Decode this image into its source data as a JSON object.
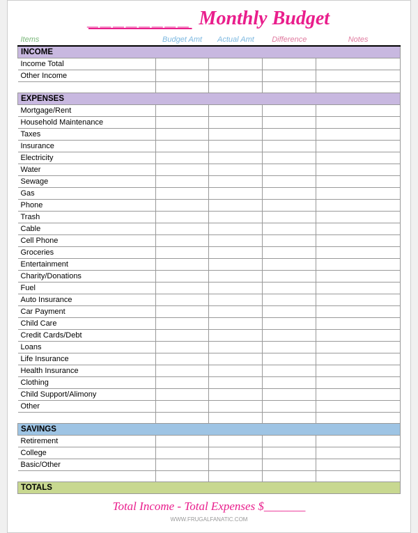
{
  "header": {
    "blank_underline": "________",
    "title": "Monthly Budget"
  },
  "columns": {
    "items": "Items",
    "budget_amt": "Budget Amt",
    "actual_amt": "Actual Amt",
    "difference": "Difference",
    "notes": "Notes"
  },
  "sections": {
    "income": {
      "label": "INCOME",
      "rows": [
        "Income Total",
        "Other Income",
        ""
      ]
    },
    "expenses": {
      "label": "EXPENSES",
      "rows": [
        "Mortgage/Rent",
        "Household Maintenance",
        "Taxes",
        "Insurance",
        "Electricity",
        "Water",
        "Sewage",
        "Gas",
        "Phone",
        "Trash",
        "Cable",
        "Cell Phone",
        "Groceries",
        "Entertainment",
        "Charity/Donations",
        "Fuel",
        "Auto Insurance",
        "Car Payment",
        "Child Care",
        "Credit Cards/Debt",
        "Loans",
        "Life Insurance",
        "Health Insurance",
        "Clothing",
        "Child Support/Alimony",
        "Other",
        ""
      ]
    },
    "savings": {
      "label": "SAVINGS",
      "rows": [
        "Retirement",
        "College",
        "Basic/Other",
        ""
      ]
    },
    "totals": {
      "label": "TOTALS"
    }
  },
  "footer": {
    "formula": "Total Income - Total Expenses $_______"
  },
  "watermark": "WWW.FRUGALFANATIC.COM"
}
